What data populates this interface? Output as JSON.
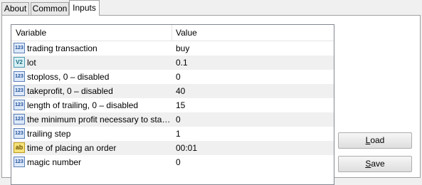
{
  "tabs": [
    {
      "label": "About",
      "active": false
    },
    {
      "label": "Common",
      "active": false
    },
    {
      "label": "Inputs",
      "active": true
    }
  ],
  "table": {
    "columns": [
      "Variable",
      "Value"
    ],
    "rows": [
      {
        "icon": "123",
        "type": "integer",
        "variable": "trading transaction",
        "value": "buy"
      },
      {
        "icon": "V2",
        "type": "double",
        "variable": "lot",
        "value": "0.1"
      },
      {
        "icon": "123",
        "type": "integer",
        "variable": "stoploss, 0 – disabled",
        "value": "0"
      },
      {
        "icon": "123",
        "type": "integer",
        "variable": "takeprofit, 0 – disabled",
        "value": "40"
      },
      {
        "icon": "123",
        "type": "integer",
        "variable": "length of trailing, 0 – disabled",
        "value": "15"
      },
      {
        "icon": "123",
        "type": "integer",
        "variable": "the minimum profit necessary to start traili...",
        "value": "0"
      },
      {
        "icon": "123",
        "type": "integer",
        "variable": "trailing step",
        "value": "1"
      },
      {
        "icon": "ab",
        "type": "string",
        "variable": "time of placing an order",
        "value": "00:01"
      },
      {
        "icon": "123",
        "type": "integer",
        "variable": "magic number",
        "value": "0"
      }
    ]
  },
  "buttons": {
    "load": {
      "first": "L",
      "rest": "oad"
    },
    "save": {
      "first": "S",
      "rest": "ave"
    }
  }
}
